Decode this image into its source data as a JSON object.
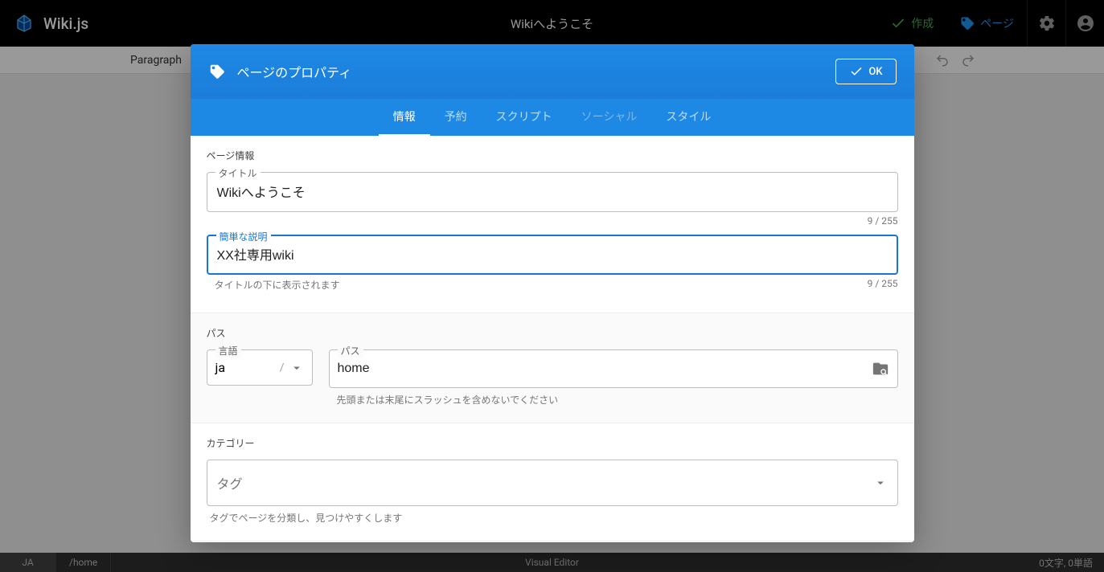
{
  "header": {
    "logo_text": "Wiki.js",
    "title": "Wikiへようこそ",
    "create_label": "作成",
    "page_label": "ページ"
  },
  "editor_bar": {
    "paragraph_label": "Paragraph"
  },
  "dialog": {
    "title": "ページのプロパティ",
    "ok_label": "OK",
    "tabs": {
      "info": "情報",
      "schedule": "予約",
      "script": "スクリプト",
      "social": "ソーシャル",
      "style": "スタイル"
    },
    "page_info": {
      "section_label": "ページ情報",
      "title_label": "タイトル",
      "title_value": "Wikiへようこそ",
      "title_counter": "9 / 255",
      "desc_label": "簡単な説明",
      "desc_value": "XX社専用wiki",
      "desc_hint": "タイトルの下に表示されます",
      "desc_counter": "9 / 255"
    },
    "path": {
      "section_label": "パス",
      "lang_label": "言語",
      "lang_value": "ja",
      "lang_sep": "/",
      "path_label": "パス",
      "path_value": "home",
      "path_hint": "先頭または末尾にスラッシュを含めないでください"
    },
    "category": {
      "section_label": "カテゴリー",
      "tag_placeholder": "タグ",
      "tag_hint": "タグでページを分類し、見つけやすくします"
    }
  },
  "status": {
    "lang": "JA",
    "path": "/home",
    "mode": "Visual Editor",
    "counts": "0文字, 0単語"
  }
}
